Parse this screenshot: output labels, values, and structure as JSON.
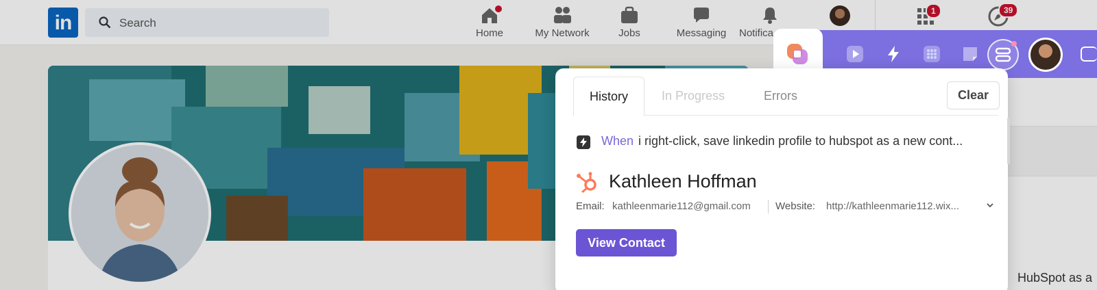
{
  "linkedin": {
    "logo_text": "in",
    "search_placeholder": "Search",
    "nav": [
      {
        "label": "Home",
        "icon": "home-icon"
      },
      {
        "label": "My Network",
        "icon": "people-icon"
      },
      {
        "label": "Jobs",
        "icon": "briefcase-icon"
      },
      {
        "label": "Messaging",
        "icon": "chat-icon"
      },
      {
        "label": "Notifica",
        "icon": "bell-icon"
      }
    ],
    "badges": {
      "grid": "1",
      "compass": "39"
    },
    "side_text": "HubSpot as a"
  },
  "extension": {
    "toolbar_icons": [
      "logo-icon",
      "play-icon",
      "lightning-icon",
      "apps-icon",
      "note-icon",
      "history-icon",
      "avatar",
      "exit-icon"
    ],
    "accent": "#7c6fe0"
  },
  "popup": {
    "tabs": {
      "history": "History",
      "in_progress": "In Progress",
      "errors": "Errors"
    },
    "clear_label": "Clear",
    "when_keyword": "When",
    "when_text": "i right-click, save linkedin profile to hubspot as a new cont...",
    "contact_name": "Kathleen Hoffman",
    "email_label": "Email:",
    "email_value": "kathleenmarie112@gmail.com",
    "website_label": "Website:",
    "website_value": "http://kathleenmarie112.wix...",
    "view_contact_label": "View Contact"
  }
}
